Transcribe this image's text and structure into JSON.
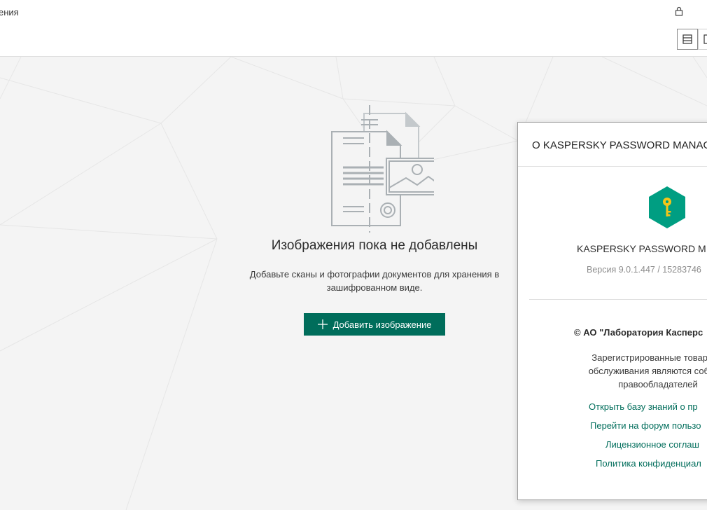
{
  "header": {
    "title": "ения",
    "lock_icon": "lock-icon",
    "view_buttons": [
      "list-view-icon",
      "grid-view-icon"
    ]
  },
  "empty_state": {
    "title": "Изображения пока не добавлены",
    "description": "Добавьте сканы и фотографии документов для хранения в зашифрованном виде.",
    "add_button_label": "Добавить изображение",
    "add_icon": "plus-icon"
  },
  "about_dialog": {
    "title": "О KASPERSKY PASSWORD MANAG",
    "logo_icon": "kaspersky-key-icon",
    "product_name": "KASPERSKY PASSWORD M",
    "version": "Версия 9.0.1.447 / 15283746",
    "copyright": "© АО \"Лаборатория Касперс",
    "trademark_lines": [
      "Зарегистрированные товарные",
      "обслуживания являются собстве",
      "правообладателей"
    ],
    "links": [
      "Открыть базу знаний о пр",
      "Перейти на форум пользо",
      "Лицензионное соглаш",
      "Политика конфиденциал"
    ]
  },
  "colors": {
    "accent": "#006d5b",
    "logo": "#009e82",
    "background": "#f4f4f4"
  }
}
